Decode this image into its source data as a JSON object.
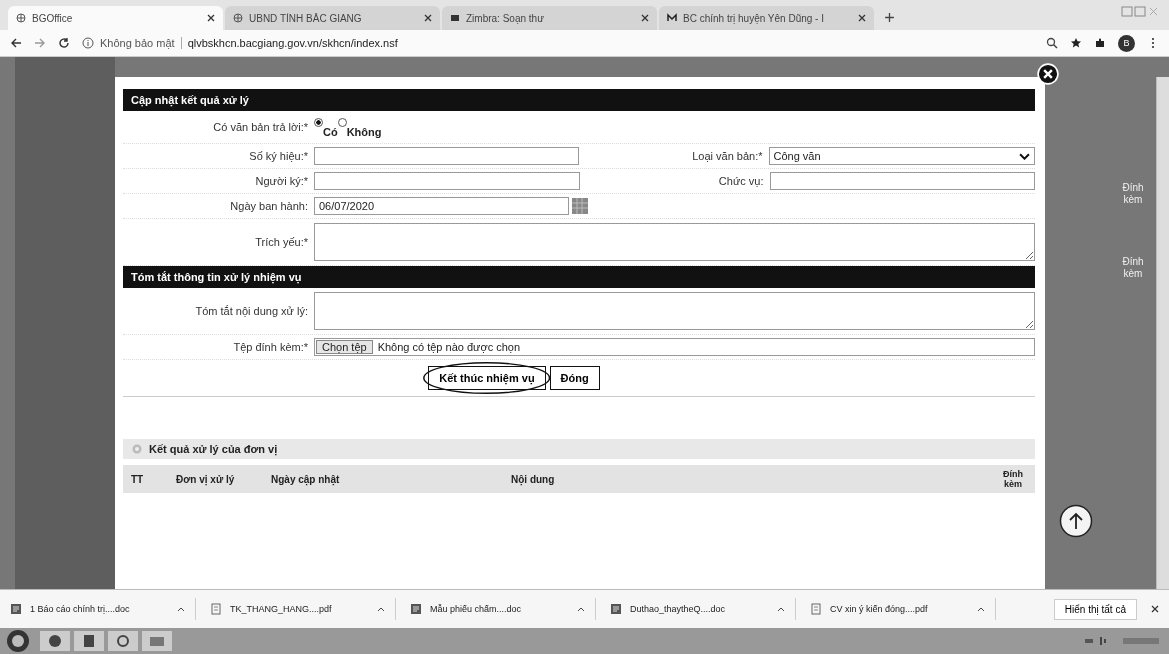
{
  "browser": {
    "tabs": [
      {
        "title": "BGOffice",
        "selected": true
      },
      {
        "title": "UBND TỈNH BẮC GIANG",
        "selected": false
      },
      {
        "title": "Zimbra: Soạn thư",
        "selected": false
      },
      {
        "title": "BC chính trị huyện Yên Dũng - I",
        "selected": false
      }
    ],
    "security": "Không bảo mật",
    "url": "qlvbskhcn.bacgiang.gov.vn/skhcn/index.nsf",
    "profile": "B"
  },
  "modal": {
    "title": "Cập nhật kết quả xử lý",
    "reply": {
      "label": "Có văn bản trả lời:*",
      "options": [
        {
          "label": "Có",
          "selected": true
        },
        {
          "label": "Không",
          "selected": false
        }
      ]
    },
    "rows": [
      [
        {
          "label": "Số ký hiệu:*",
          "kind": "text"
        },
        {
          "label": "Loại văn bản:*",
          "kind": "select",
          "value": "Công văn"
        }
      ],
      [
        {
          "label": "Người ký:*",
          "kind": "text"
        },
        {
          "label": "Chức vụ:",
          "kind": "text"
        }
      ],
      [
        {
          "label": "Ngày ban hành:",
          "kind": "date",
          "value": "06/07/2020"
        }
      ],
      [
        {
          "label": "Trích yếu:*",
          "kind": "textarea"
        }
      ]
    ],
    "summary_title": "Tóm tắt thông tin xử lý nhiệm vụ",
    "summary": {
      "label": "Tóm tắt nội dung xử lý:"
    },
    "attachment": {
      "label": "Tệp đính kèm:*",
      "button": "Chọn tệp",
      "status": "Không có tệp nào được chọn"
    },
    "buttons": [
      {
        "label": "Kết thúc nhiệm vụ",
        "circled": true
      },
      {
        "label": "Đóng",
        "circled": false
      }
    ],
    "results": {
      "title": "Kết quả xử lý của đơn vị",
      "columns": [
        "TT",
        "Đơn vị xử lý",
        "Ngày cập nhật",
        "Nội dung",
        "Đính kèm"
      ]
    }
  },
  "background_headers": [
    "Đính kèm",
    "Đính kèm"
  ],
  "downloads": {
    "items": [
      {
        "name": "1 Báo cáo chính trị....doc",
        "kind": "doc"
      },
      {
        "name": "TK_THANG_HANG....pdf",
        "kind": "pdf"
      },
      {
        "name": "Mẫu phiếu chấm....doc",
        "kind": "doc"
      },
      {
        "name": "Duthao_thaytheQ....doc",
        "kind": "doc"
      },
      {
        "name": "CV xin ý kiến đóng....pdf",
        "kind": "pdf"
      }
    ],
    "show_all": "Hiển thị tất cả"
  }
}
